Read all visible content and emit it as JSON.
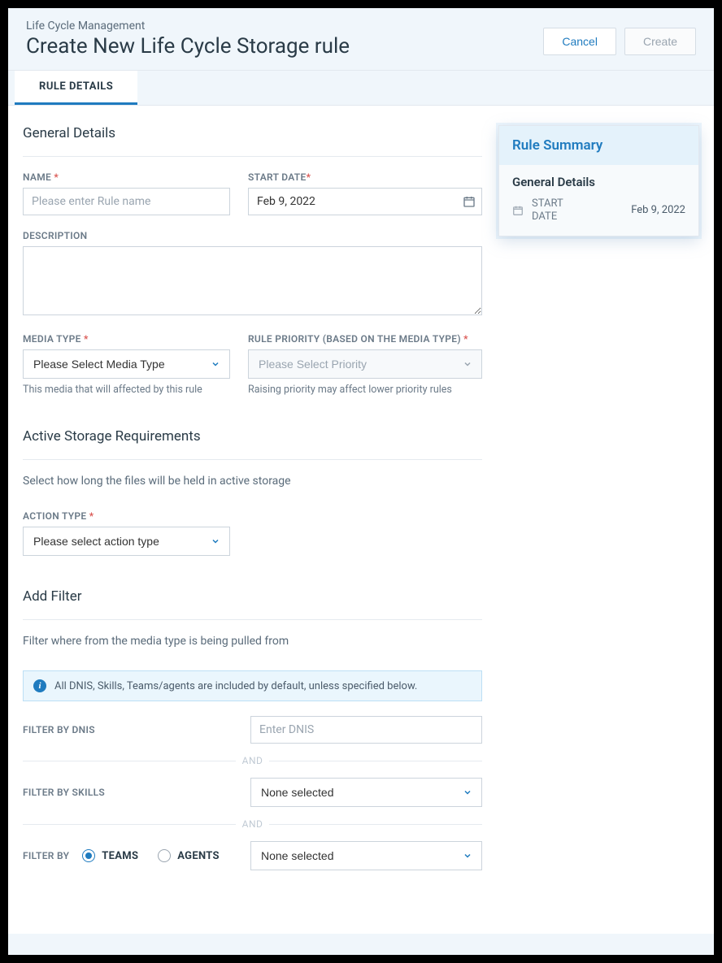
{
  "header": {
    "breadcrumb": "Life Cycle Management",
    "title": "Create New Life Cycle Storage rule",
    "cancel": "Cancel",
    "create": "Create"
  },
  "tabs": {
    "rule_details": "RULE DETAILS"
  },
  "general": {
    "section": "General Details",
    "name_label": "NAME",
    "name_placeholder": "Please enter Rule name",
    "start_label": "START DATE",
    "start_value": "Feb 9, 2022",
    "desc_label": "DESCRIPTION",
    "media_label": "MEDIA TYPE",
    "media_placeholder": "Please Select Media Type",
    "media_helper": "This media that will affected by this rule",
    "priority_label": "RULE PRIORITY (BASED ON THE MEDIA TYPE)",
    "priority_placeholder": "Please Select Priority",
    "priority_helper": "Raising priority may affect lower priority rules"
  },
  "storage": {
    "section": "Active Storage Requirements",
    "desc": "Select how long the files will be held in active storage",
    "action_label": "ACTION TYPE",
    "action_placeholder": "Please select action type"
  },
  "filter": {
    "section": "Add Filter",
    "desc": "Filter where from the media type is being pulled from",
    "info": "All DNIS, Skills, Teams/agents are included by default, unless specified below.",
    "dnis_label": "FILTER BY DNIS",
    "dnis_placeholder": "Enter DNIS",
    "skills_label": "FILTER BY SKILLS",
    "none_selected": "None selected",
    "and": "AND",
    "by_label": "FILTER BY",
    "teams": "TEAMS",
    "agents": "AGENTS"
  },
  "summary": {
    "title": "Rule Summary",
    "section": "General Details",
    "start_key": "START DATE",
    "start_val": "Feb 9, 2022"
  }
}
